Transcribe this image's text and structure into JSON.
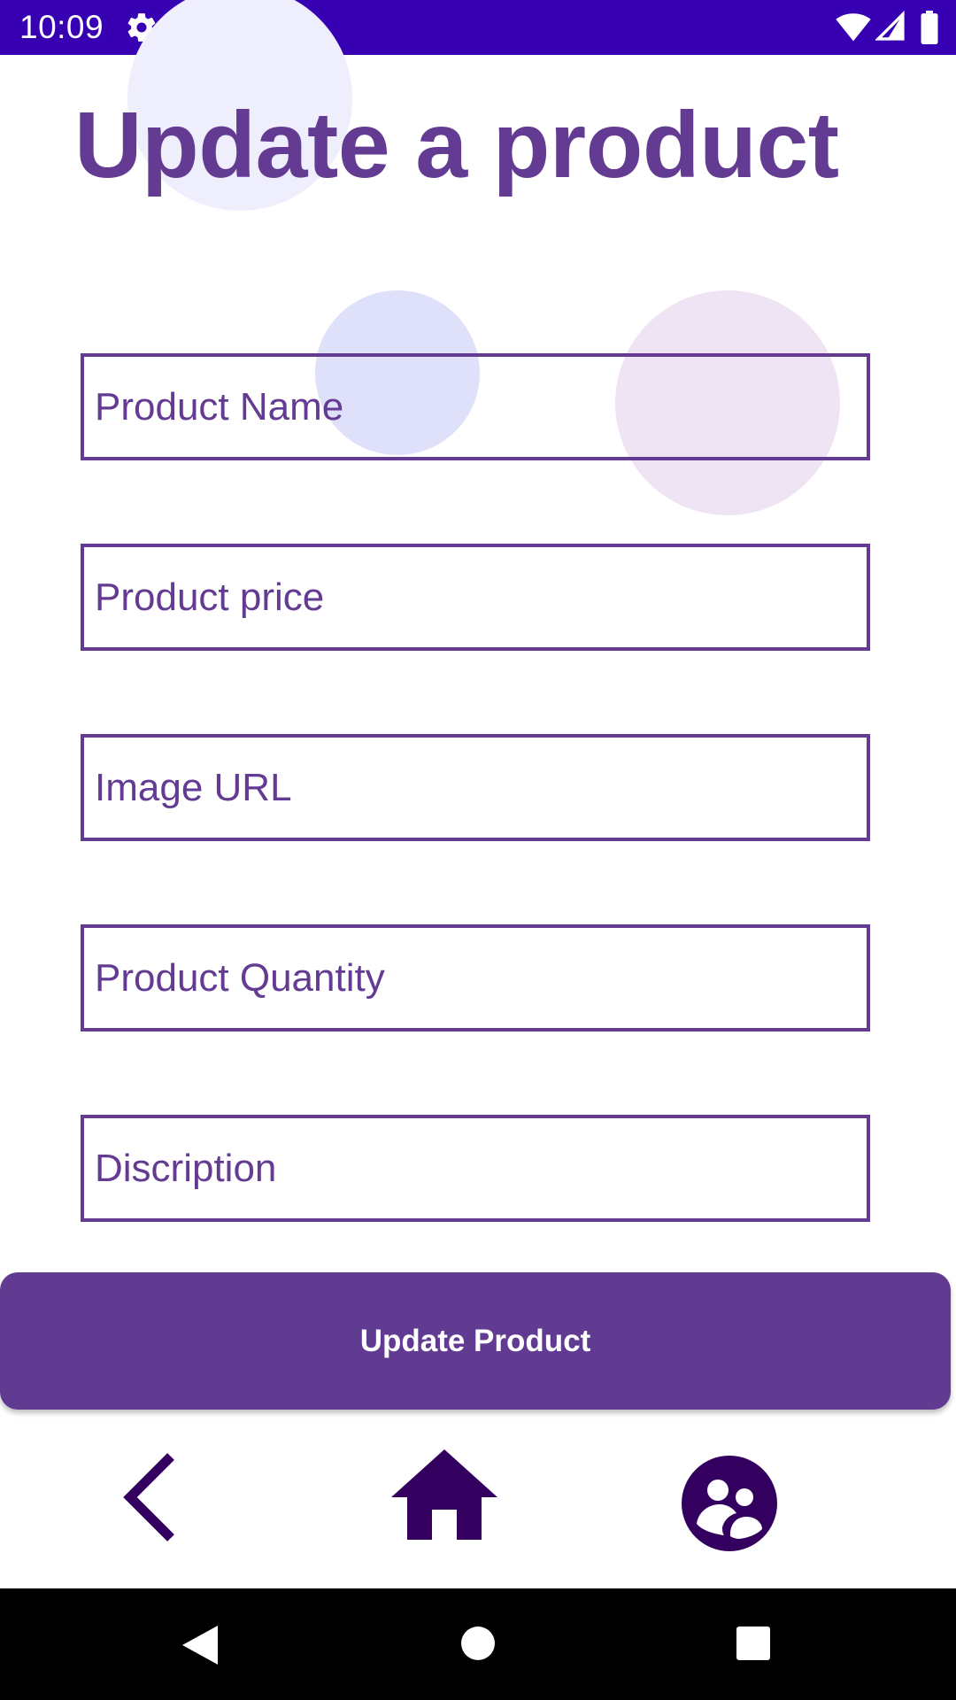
{
  "status_bar": {
    "time": "10:09",
    "icons": [
      "settings-icon",
      "shield-icon",
      "sd-card-icon",
      "wifi-icon",
      "signal-icon",
      "battery-icon"
    ],
    "background": "#3700b3"
  },
  "page": {
    "title": "Update a product"
  },
  "form": {
    "fields": [
      {
        "placeholder": "Product Name",
        "value": ""
      },
      {
        "placeholder": "Product price",
        "value": ""
      },
      {
        "placeholder": "Image URL",
        "value": ""
      },
      {
        "placeholder": "Product Quantity",
        "value": ""
      },
      {
        "placeholder": "Discription",
        "value": ""
      }
    ],
    "submit_label": "Update Product"
  },
  "bottom_nav": {
    "items": [
      "back-chevron-icon",
      "home-icon",
      "community-icon"
    ]
  },
  "system_nav": {
    "items": [
      "system-back-icon",
      "system-home-icon",
      "system-recents-icon"
    ]
  },
  "colors": {
    "primary": "#643b92",
    "button": "#613b91",
    "nav_icon": "#33005f"
  }
}
